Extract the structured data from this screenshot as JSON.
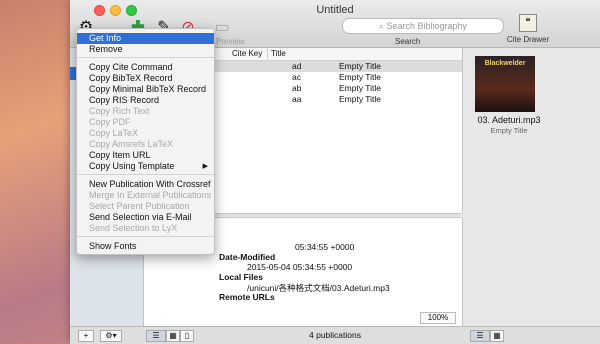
{
  "window": {
    "title": "Untitled"
  },
  "toolbar": {
    "search_placeholder": "Search Bibliography",
    "search_label": "Search",
    "preview_label": "Preview",
    "cite_drawer_label": "Cite Drawer"
  },
  "table": {
    "headers": [
      "Cite Key",
      "Title"
    ],
    "rows": [
      {
        "key": "ad",
        "title": "Empty Title"
      },
      {
        "key": "ac",
        "title": "Empty Title"
      },
      {
        "key": "ab",
        "title": "Empty Title"
      },
      {
        "key": "aa",
        "title": "Empty Title"
      }
    ]
  },
  "detail": {
    "date1": "05:34:55 +0000",
    "date_modified_label": "Date-Modified",
    "date_modified": "2015-05-04 05:34:55 +0000",
    "local_files_label": "Local Files",
    "local_file_path": "/unicuni/各种格式文档/03.Adeturi.mp3",
    "remote_urls_label": "Remote URLs",
    "zoom": "100%"
  },
  "right_panel": {
    "album_text": "Blackwelder",
    "file_name": "03. Adeturi.mp3",
    "file_title": "Empty Title"
  },
  "status": {
    "text": "4 publications"
  },
  "context_menu": {
    "items": [
      {
        "label": "Get Info",
        "disabled": false,
        "highlighted": true
      },
      {
        "label": "Remove",
        "disabled": false
      },
      {
        "label": "Copy Cite Command",
        "disabled": false
      },
      {
        "label": "Copy BibTeX Record",
        "disabled": false
      },
      {
        "label": "Copy Minimal BibTeX Record",
        "disabled": false
      },
      {
        "label": "Copy RIS Record",
        "disabled": false
      },
      {
        "label": "Copy Rich Text",
        "disabled": true
      },
      {
        "label": "Copy PDF",
        "disabled": true
      },
      {
        "label": "Copy LaTeX",
        "disabled": true
      },
      {
        "label": "Copy Amsrefs LaTeX",
        "disabled": true
      },
      {
        "label": "Copy Item URL",
        "disabled": false
      },
      {
        "label": "Copy Using Template",
        "disabled": false,
        "submenu": true
      },
      {
        "label": "New Publication With Crossref",
        "disabled": false
      },
      {
        "label": "Merge In External Publications",
        "disabled": true
      },
      {
        "label": "Select Parent Publication",
        "disabled": true
      },
      {
        "label": "Send Selection via E-Mail",
        "disabled": false
      },
      {
        "label": "Send Selection to LyX",
        "disabled": true
      },
      {
        "label": "Show Fonts",
        "disabled": false
      }
    ]
  },
  "colors": {
    "highlight": "#2f6fd8",
    "disabled_text": "#a9a9a9"
  }
}
